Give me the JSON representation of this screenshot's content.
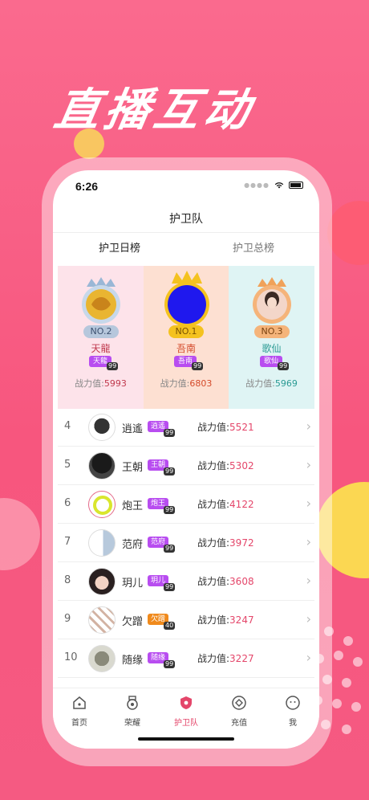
{
  "headline": "直播互动",
  "status": {
    "time": "6:26"
  },
  "nav": {
    "title": "护卫队"
  },
  "tabs": [
    {
      "label": "护卫日榜",
      "active": true
    },
    {
      "label": "护卫总榜",
      "active": false
    }
  ],
  "podium": [
    {
      "rank_label": "NO.2",
      "name": "天龍",
      "tag": "天龍",
      "level": "99",
      "power_label": "战力值:",
      "power": "5993",
      "bg": "#fde3ea",
      "name_color": "#c0394d"
    },
    {
      "rank_label": "NO.1",
      "name": "吾南",
      "tag": "吾南",
      "level": "99",
      "power_label": "战力值:",
      "power": "6803",
      "bg": "#fde0d2",
      "name_color": "#d44a2a"
    },
    {
      "rank_label": "NO.3",
      "name": "歌仙",
      "tag": "歌仙",
      "level": "99",
      "power_label": "战力值:",
      "power": "5969",
      "bg": "#dff4f4",
      "name_color": "#2a9a93"
    }
  ],
  "list": [
    {
      "index": "4",
      "name": "逍遙",
      "tag": "逍遙",
      "tag_color": "purple",
      "level": "99",
      "power_label": "战力值:",
      "power": "5521"
    },
    {
      "index": "5",
      "name": "王朝",
      "tag": "王朝",
      "tag_color": "purple",
      "level": "99",
      "power_label": "战力值:",
      "power": "5302"
    },
    {
      "index": "6",
      "name": "炮王",
      "tag": "炮王",
      "tag_color": "purple",
      "level": "99",
      "power_label": "战力值:",
      "power": "4122"
    },
    {
      "index": "7",
      "name": "范府",
      "tag": "范府",
      "tag_color": "purple",
      "level": "99",
      "power_label": "战力值:",
      "power": "3972"
    },
    {
      "index": "8",
      "name": "玥儿",
      "tag": "玥儿",
      "tag_color": "purple",
      "level": "99",
      "power_label": "战力值:",
      "power": "3608"
    },
    {
      "index": "9",
      "name": "欠蹭",
      "tag": "欠蹭",
      "tag_color": "orange",
      "level": "40",
      "power_label": "战力值:",
      "power": "3247"
    },
    {
      "index": "10",
      "name": "随缘",
      "tag": "随缘",
      "tag_color": "purple",
      "level": "99",
      "power_label": "战力值:",
      "power": "3227"
    }
  ],
  "tabbar": [
    {
      "label": "首页",
      "icon": "home-icon",
      "active": false
    },
    {
      "label": "荣耀",
      "icon": "medal-icon",
      "active": false
    },
    {
      "label": "护卫队",
      "icon": "shield-icon",
      "active": true
    },
    {
      "label": "充值",
      "icon": "diamond-icon",
      "active": false
    },
    {
      "label": "我",
      "icon": "profile-icon",
      "active": false
    }
  ],
  "colors": {
    "accent": "#e4466a",
    "tag_purple": "#b84df0",
    "tag_orange": "#f08a1c"
  }
}
